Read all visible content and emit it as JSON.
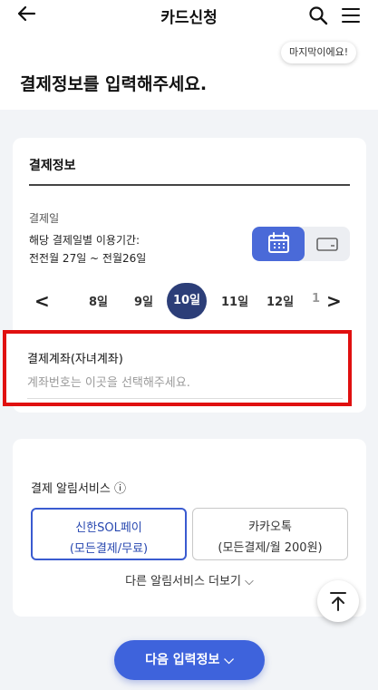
{
  "topbar": {
    "title": "카드신청",
    "back_icon": "arrow-left-icon",
    "search_icon": "search-icon",
    "menu_icon": "hamburger-menu-icon"
  },
  "header": {
    "bubble": "마지막이에요!",
    "heading": "결제정보를 입력해주세요."
  },
  "payment": {
    "section_title": "결제정보",
    "pay_day_label": "결제일",
    "period_line1": "해당 결제일별 이용기간:",
    "period_line2": "전전월 27일 ~ 전월26일",
    "view_toggle": {
      "calendar_icon": "calendar-icon",
      "card_icon": "card-icon",
      "selected": "calendar"
    },
    "days": {
      "prev_partial": "",
      "items": [
        "8일",
        "9일",
        "10일",
        "11일",
        "12일"
      ],
      "selected": "10일",
      "next_partial": "1"
    },
    "account": {
      "label": "결제계좌(자녀계좌)",
      "placeholder": "계좌번호는 이곳을 선택해주세요."
    }
  },
  "notify": {
    "title": "결제 알림서비스 ⓘ",
    "options": [
      {
        "line1": "신한SOL페이",
        "line2": "(모든결제/무료)",
        "selected": true
      },
      {
        "line1": "카카오톡",
        "line2": "(모든결제/월 200원)",
        "selected": false
      }
    ],
    "more": "다른 알림서비스 더보기 ⌵"
  },
  "scroll_top_icon": "arrow-up-icon",
  "next_button": "다음 입력정보 ⌵",
  "colors": {
    "primary": "#3e63dc",
    "selected_day": "#2c3e78",
    "highlight_border": "#e01010"
  }
}
